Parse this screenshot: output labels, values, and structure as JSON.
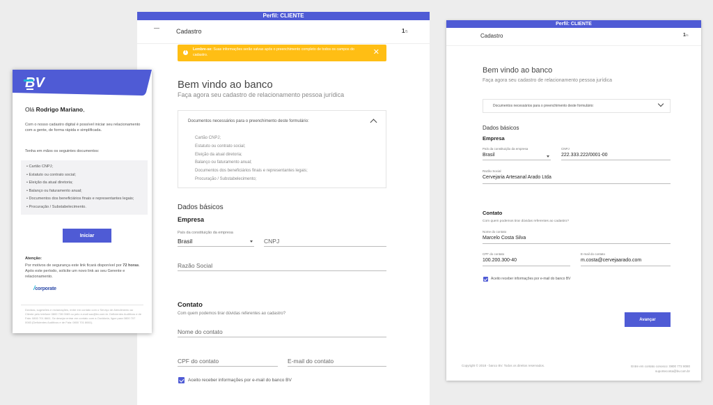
{
  "colors": {
    "brand": "#4f5bd5",
    "alert": "#ffbe14",
    "background": "#ededed"
  },
  "email": {
    "logo_text": "BV",
    "greeting_prefix": "Olá ",
    "greeting_name": "Rodrigo Mariano",
    "greeting_suffix": ",",
    "intro": "Com o nosso cadastro digital é possível iniciar seu relacionamento com a gente, de forma rápida e simplificada.",
    "docs_intro": "Tenha em mãos os seguintes documentos:",
    "docs": [
      "• Cartão CNPJ;",
      "• Estatuto ou contrato social;",
      "• Eleição da atual diretoria;",
      "• Balanço ou faturamento anual;",
      "• Documentos dos beneficiários finais e representantes legais;",
      "• Procuração / Substabelecimento."
    ],
    "button": "Iniciar",
    "attention_title": "Atenção:",
    "attention_prefix": "Por motivos de segurança este link ficará disponível por ",
    "attention_hours": "72 horas",
    "attention_suffix": ". Após este período, solicite um novo link ao seu Gerente e relacionamento.",
    "partner_slash": "/",
    "partner_name": "corporate",
    "footer": "Dúvidas, sugestões e reclamações, entre em contato com o Serviço de Atendimento ao Cliente pelo telefone 0800 728 0083 ou pelo e-mail sac@bv.com.br. Deficientes Auditivos e de Fala: 0800 701 8661. Se desejar entrar em contato com a Ouvidoria, ligue para 0800 707 0083 (Deficientes Auditivos e de Fala: 0800 701 8661)."
  },
  "middle": {
    "profile_bar": "Perfil: CLIENTE",
    "header_title": "Cadastro",
    "step_current": "1",
    "step_total": "/5",
    "alert_bold": "Lembre-se:",
    "alert_text": " Suas informações serão salvas após o preenchimento completo de todos os campos do cadastro.",
    "alert_icon": "!",
    "alert_close": "✕",
    "welcome": "Bem vindo ao banco",
    "subtitle": "Faça agora seu cadastro de relacionamento pessoa jurídica",
    "accordion_title": "Documentos necessários para o preenchimento deste formulário:",
    "accordion_items": [
      "Cartão CNPJ;",
      "Estatuto ou contrato social;",
      "Eleição da atual diretoria;",
      "Balanço ou faturamento anual;",
      "Documentos dos beneficiários finais e representantes legais;",
      "Procuração / Substabelecimento;"
    ],
    "section_basic": "Dados básicos",
    "section_company": "Empresa",
    "country_label": "País da constituição da empresa",
    "country_value": "Brasil",
    "cnpj_placeholder": "CNPJ",
    "razao_placeholder": "Razão Social",
    "section_contact": "Contato",
    "contact_question": "Com quem podemos tirar dúvidas referentes ao cadastro?",
    "contact_name_placeholder": "Nome do contato",
    "cpf_placeholder": "CPF do contato",
    "email_placeholder": "E-mail do contato",
    "checkbox_label": "Aceito receber informações por e-mail do banco BV"
  },
  "right": {
    "profile_bar": "Perfil: CLIENTE",
    "header_title": "Cadastro",
    "step_current": "1",
    "step_total": "/5",
    "welcome": "Bem vindo ao banco",
    "subtitle": "Faça agora seu cadastro de relacionamento pessoa jurídica",
    "accordion_title": "Documentos necessários para o preenchimento deste formulário:",
    "section_basic": "Dados básicos",
    "section_company": "Empresa",
    "country_label": "País da constituição da empresa",
    "country_value": "Brasil",
    "cnpj_label": "CNPJ",
    "cnpj_value": "222.333.222/0001-00",
    "razao_label": "Razão Social",
    "razao_value": "Cervejaria Artesanal Arado Ltda",
    "section_contact": "Contato",
    "contact_question": "Com quem podemos tirar dúvidas referentes ao cadastro?",
    "contact_name_label": "Nome do contato",
    "contact_name_value": "Marcelo Costa Silva",
    "cpf_label": "CPF do contato",
    "cpf_value": "100.200.300-40",
    "email_label": "E-mail do contato",
    "email_value": "m.costa@cervejaarado.com",
    "checkbox_label": "Aceito receber informações por e-mail do banco BV",
    "button": "Avançar",
    "footer_left": "Copyright © 2018 - banco BV. Todos os direitos reservados.",
    "footer_right_1": "Entre em contato conosco: 0800 772 8080",
    "footer_right_2": "suporteconta@bv.com.br"
  }
}
